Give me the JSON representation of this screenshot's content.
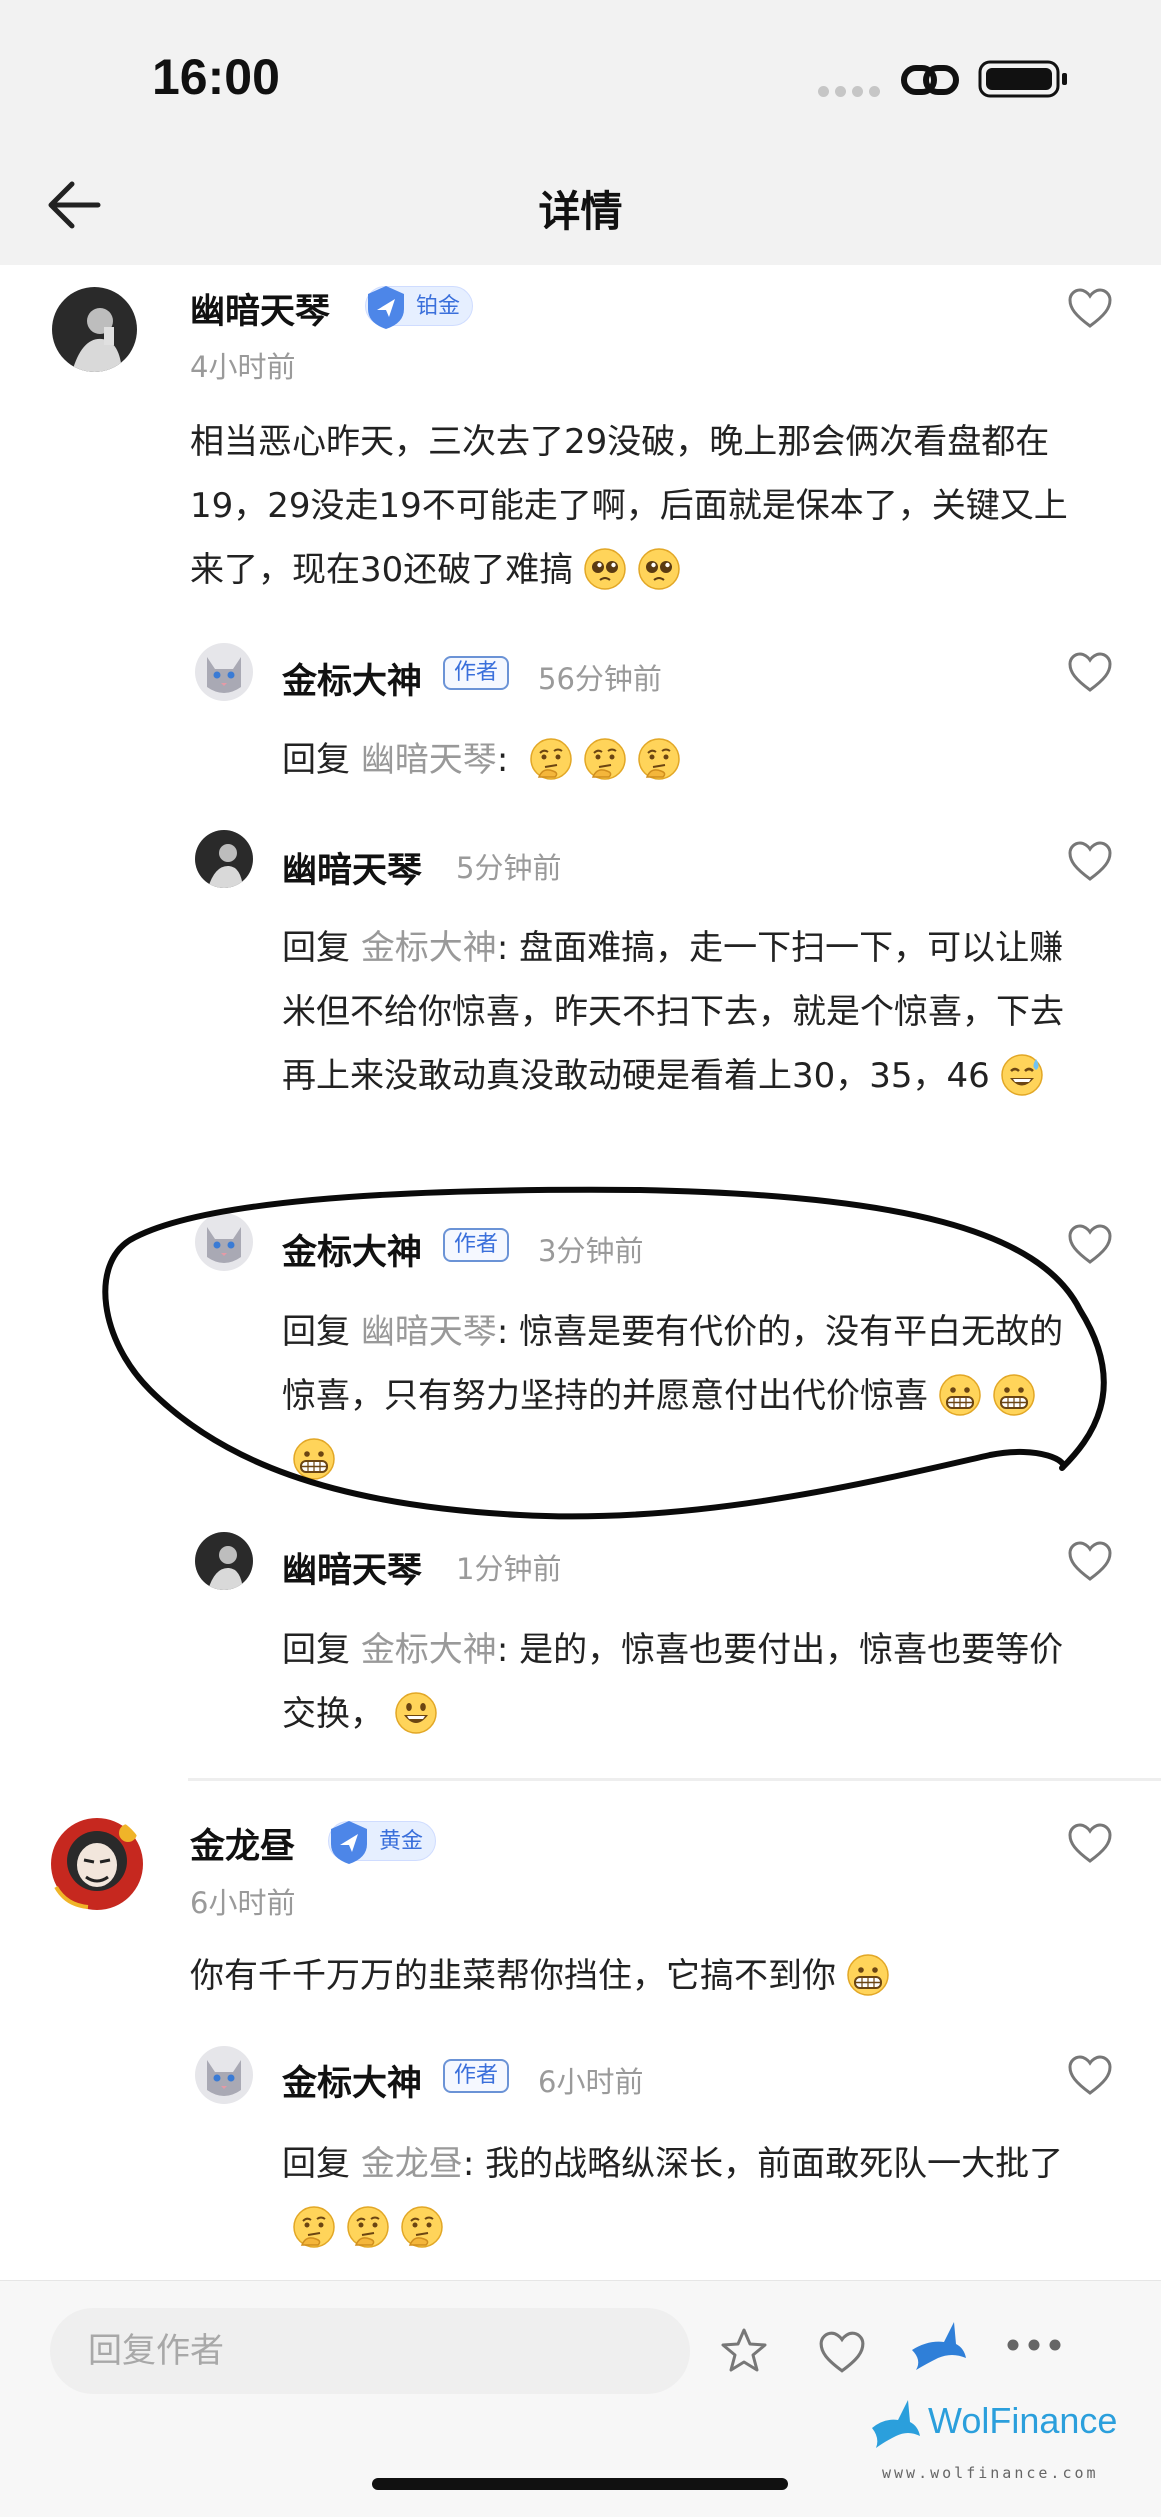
{
  "status_bar": {
    "time": "16:00"
  },
  "nav": {
    "title": "详情"
  },
  "colors": {
    "accent": "#3a6fdb",
    "muted": "#9a9a9a",
    "ink": "#111111"
  },
  "comments": [
    {
      "user": "幽暗天琴",
      "badge": "铂金",
      "time": "4小时前",
      "text": "相当恶心昨天，三次去了29没破，晚上那会俩次看盘都在19，29没走19不可能走了啊，后面就是保本了，关键又上来了，现在30还破了难搞",
      "emojis": [
        "pleading-face",
        "pleading-face"
      ],
      "replies": [
        {
          "user": "金标大神",
          "tag": "作者",
          "time": "56分钟前",
          "reply_prefix": "回复",
          "reply_to": "幽暗天琴",
          "text": "",
          "emojis": [
            "thinking-face",
            "thinking-face",
            "thinking-face"
          ]
        },
        {
          "user": "幽暗天琴",
          "tag": "",
          "time": "5分钟前",
          "reply_prefix": "回复",
          "reply_to": "金标大神",
          "text": "盘面难搞，走一下扫一下，可以让赚米但不给你惊喜，昨天不扫下去，就是个惊喜，下去再上来没敢动真没敢动硬是看着上30，35，46",
          "emojis": [
            "grinning-sweat-face"
          ]
        },
        {
          "user": "金标大神",
          "tag": "作者",
          "time": "3分钟前",
          "reply_prefix": "回复",
          "reply_to": "幽暗天琴",
          "text": "惊喜是要有代价的，没有平白无故的惊喜，只有努力坚持的并愿意付出代价惊喜",
          "emojis": [
            "grimacing-face",
            "grimacing-face",
            "grimacing-face"
          ]
        },
        {
          "user": "幽暗天琴",
          "tag": "",
          "time": "1分钟前",
          "reply_prefix": "回复",
          "reply_to": "金标大神",
          "text": "是的，惊喜也要付出，惊喜也要等价交换，",
          "emojis": [
            "smiling-face"
          ]
        }
      ]
    },
    {
      "user": "金龙昼",
      "badge": "黄金",
      "time": "6小时前",
      "text": "你有千千万万的韭菜帮你挡住，它搞不到你",
      "emojis": [
        "grimacing-face"
      ],
      "replies": [
        {
          "user": "金标大神",
          "tag": "作者",
          "time": "6小时前",
          "reply_prefix": "回复",
          "reply_to": "金龙昼",
          "text": "我的战略纵深长，前面敢死队一大批了",
          "emojis": [
            "thinking-face",
            "thinking-face",
            "thinking-face"
          ]
        }
      ]
    }
  ],
  "bottom_bar": {
    "reply_placeholder": "回复作者"
  },
  "watermark": {
    "brand": "WolFinance",
    "url": "www.wolfinance.com"
  }
}
